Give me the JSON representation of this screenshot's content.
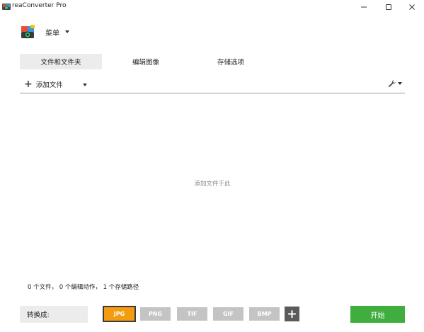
{
  "window": {
    "title": "reaConverter Pro"
  },
  "menu": {
    "label": "菜单"
  },
  "tabs": [
    {
      "label": "文件和文件夹",
      "active": true
    },
    {
      "label": "编辑图像",
      "active": false
    },
    {
      "label": "存储选项",
      "active": false
    }
  ],
  "toolbar": {
    "add_files_label": "添加文件"
  },
  "dropzone": {
    "hint": "添加文件于此"
  },
  "status": {
    "text": "0 个文件， 0 个编辑动作， 1 个存储路径"
  },
  "convert": {
    "label": "转换成:",
    "formats": [
      {
        "label": "JPG",
        "active": true
      },
      {
        "label": "PNG",
        "active": false
      },
      {
        "label": "TIF",
        "active": false
      },
      {
        "label": "GIF",
        "active": false
      },
      {
        "label": "BMP",
        "active": false
      }
    ],
    "add_format_label": "+"
  },
  "start_button": {
    "label": "开始"
  },
  "colors": {
    "accent_orange": "#f39c12",
    "start_green": "#3fae3f",
    "format_gray": "#c4c4c4"
  },
  "icons": [
    "app-icon",
    "menu-logo-icon",
    "minimize-icon",
    "maximize-icon",
    "close-icon",
    "plus-icon",
    "wrench-icon",
    "chevron-down-icon"
  ]
}
